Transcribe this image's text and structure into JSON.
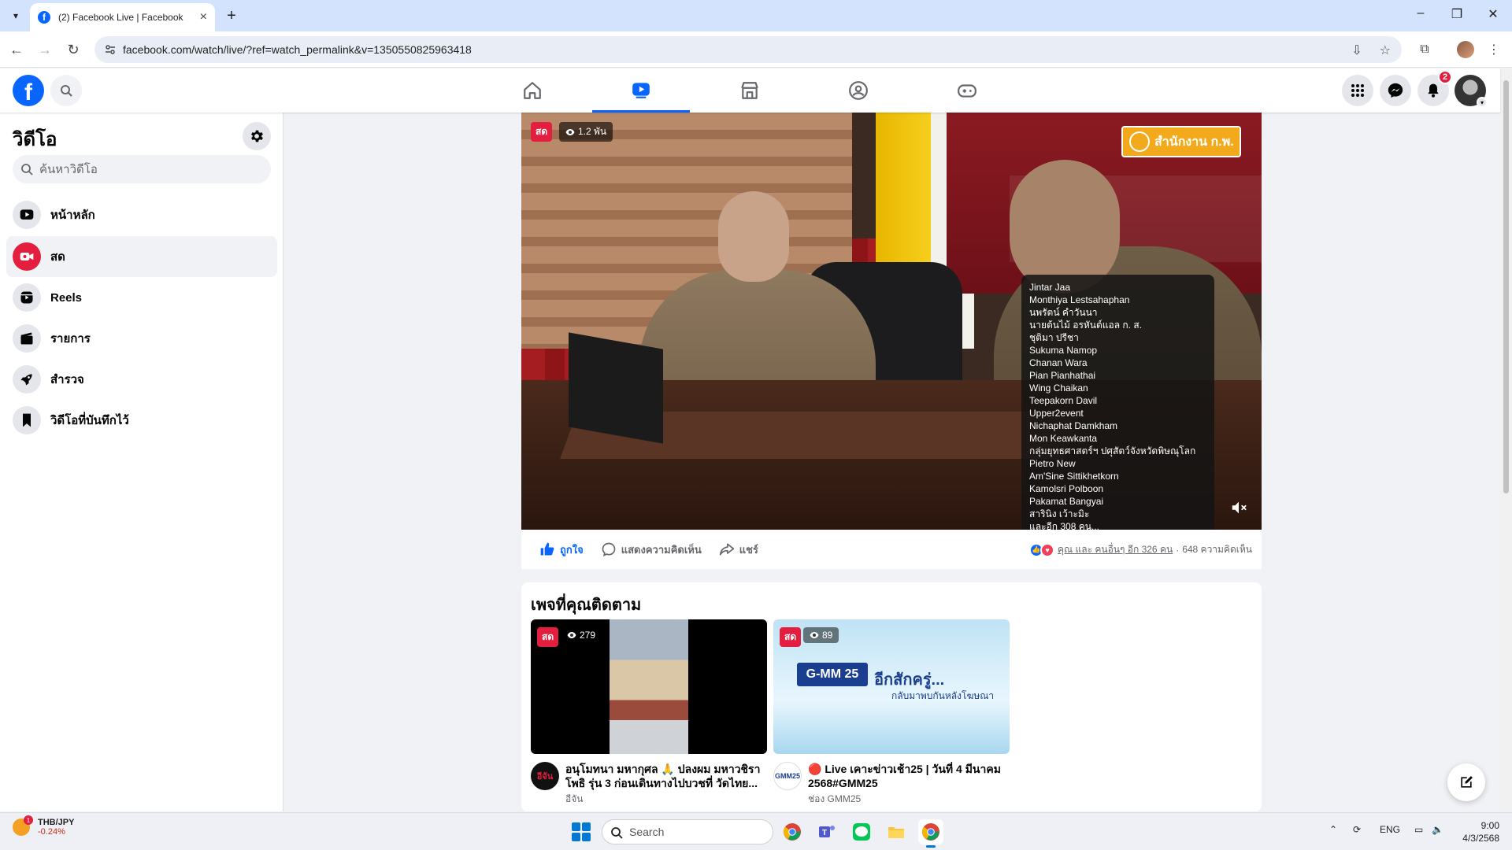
{
  "browser": {
    "tab_title": "(2) Facebook Live | Facebook",
    "url": "facebook.com/watch/live/?ref=watch_permalink&v=1350550825963418"
  },
  "facebook": {
    "notification_count": "2"
  },
  "sidebar": {
    "title": "วิดีโอ",
    "search_placeholder": "ค้นหาวิดีโอ",
    "items": [
      {
        "label": "หน้าหลัก",
        "icon": "video-home-icon"
      },
      {
        "label": "สด",
        "icon": "live-camera-icon",
        "active": true
      },
      {
        "label": "Reels",
        "icon": "reels-icon"
      },
      {
        "label": "รายการ",
        "icon": "shows-icon"
      },
      {
        "label": "สำรวจ",
        "icon": "explore-rocket-icon"
      },
      {
        "label": "วิดีโอที่บันทึกไว้",
        "icon": "saved-bookmark-icon"
      }
    ]
  },
  "video": {
    "live_label": "สด",
    "viewers": "1.2 พัน",
    "channel_logo_text": "สำนักงาน ก.พ.",
    "viewer_names": [
      "Jintar Jaa",
      "Monthiya Lestsahaphan",
      "นพรัตน์ คำวันนา",
      "นายต้นไม้ อรหันต์แอล ก. ส.",
      "ชุติมา ปรีชา",
      "Sukuma Namop",
      "Chanan Wara",
      "Pian Pianhathai",
      "Wing Chaikan",
      "Teepakorn Davil",
      "Upper2event",
      "Nichaphat Damkham",
      "Mon Keawkanta",
      "กลุ่มยุทธศาสตร์ฯ ปศุสัตว์จังหวัดพิษณุโลก",
      "Pietro New",
      "Am'Sine Sittikhetkorn",
      "Kamolsri Polboon",
      "Pakamat Bangyai",
      "สารินิง เว้าะมิะ",
      "และอีก 308 คน..."
    ]
  },
  "actions": {
    "like": "ถูกใจ",
    "comment": "แสดงความคิดเห็น",
    "share": "แชร์",
    "reactions_text": "คุณ และ คนอื่นๆ อีก 326 คน",
    "comments_count": "648 ความคิดเห็น"
  },
  "followed_pages": {
    "title": "เพจที่คุณติดตาม",
    "cards": [
      {
        "live_label": "สด",
        "viewers": "279",
        "avatar_text": "อีจัน",
        "title": "อนุโมทนา มหากุศล 🙏 ปลงผม มหาวชิรา โพธิ รุ่น 3 ก่อนเดินทางไปบวชที่ วัดไทย...",
        "page": "อีจัน"
      },
      {
        "live_label": "สด",
        "viewers": "89",
        "avatar_text": "GMM25",
        "title": "🔴 Live เคาะข่าวเช้า25 | วันที่ 4 มีนาคม 2568#GMM25",
        "page": "ช่อง GMM25",
        "thumb_logo": "G-MM 25",
        "thumb_text": "อีกสักครู่...",
        "thumb_sub": "กลับมาพบกันหลังโฆษณา"
      }
    ]
  },
  "taskbar": {
    "ticker_name": "THB/JPY",
    "ticker_change": "-0.24%",
    "ticker_badge": "1",
    "search_placeholder": "Search",
    "lang": "ENG",
    "time": "9:00",
    "date": "4/3/2568"
  },
  "colors": {
    "fb_blue": "#0866ff",
    "live_red": "#e41e3f",
    "tab_bar": "#d3e3fd"
  }
}
